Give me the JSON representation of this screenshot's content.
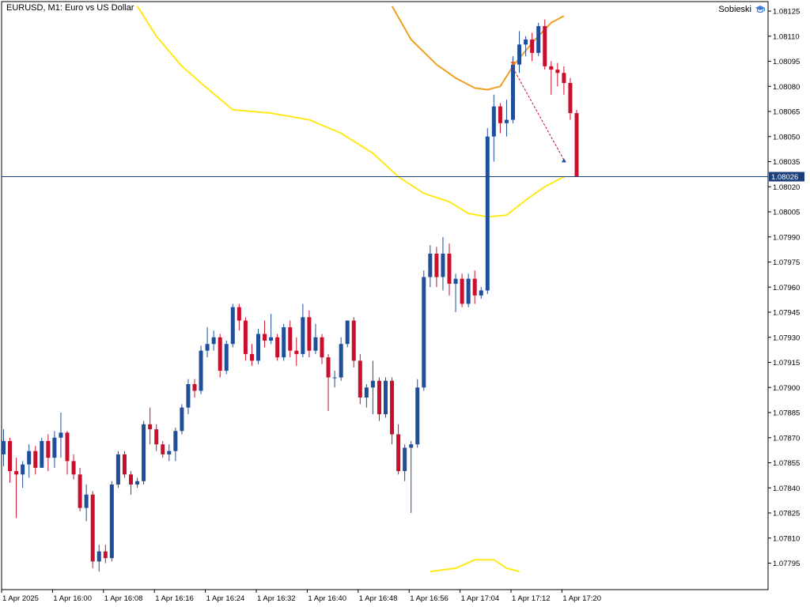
{
  "header": {
    "symbol_label": "EURUSD, M1:  Euro vs US Dollar",
    "account_name": "Sobieski",
    "account_icon": "graduation-cap-icon"
  },
  "colors": {
    "bull": "#1f4e9b",
    "bear": "#c8102e",
    "band_lower": "#ffe81a",
    "band_upper": "#f0a020",
    "price_line": "#1a3f7a",
    "axis": "#000000"
  },
  "chart_data": {
    "type": "candlestick",
    "symbol": "EURUSD",
    "timeframe": "M1",
    "ylim": [
      1.0779,
      1.0813
    ],
    "y_ticks": [
      "1.08125",
      "1.08110",
      "1.08095",
      "1.08080",
      "1.08065",
      "1.08050",
      "1.08035",
      "1.08020",
      "1.08005",
      "1.07990",
      "1.07975",
      "1.07960",
      "1.07945",
      "1.07930",
      "1.07915",
      "1.07900",
      "1.07885",
      "1.07870",
      "1.07855",
      "1.07840",
      "1.07825",
      "1.07810",
      "1.07795"
    ],
    "x_ticks": [
      "1 Apr 2025",
      "1 Apr 16:00",
      "1 Apr 16:08",
      "1 Apr 16:16",
      "1 Apr 16:24",
      "1 Apr 16:32",
      "1 Apr 16:40",
      "1 Apr 16:48",
      "1 Apr 16:56",
      "1 Apr 17:04",
      "1 Apr 17:12",
      "1 Apr 17:20"
    ],
    "current_price": "1.08026",
    "candles": [
      {
        "o": 1.0786,
        "h": 1.07875,
        "l": 1.07853,
        "c": 1.07868
      },
      {
        "o": 1.07868,
        "h": 1.0787,
        "l": 1.07843,
        "c": 1.0785
      },
      {
        "o": 1.0785,
        "h": 1.07858,
        "l": 1.07822,
        "c": 1.07848
      },
      {
        "o": 1.07848,
        "h": 1.07856,
        "l": 1.0784,
        "c": 1.07854
      },
      {
        "o": 1.07854,
        "h": 1.07866,
        "l": 1.07846,
        "c": 1.07862
      },
      {
        "o": 1.07862,
        "h": 1.07865,
        "l": 1.07848,
        "c": 1.07852
      },
      {
        "o": 1.07852,
        "h": 1.0787,
        "l": 1.07852,
        "c": 1.07868
      },
      {
        "o": 1.07868,
        "h": 1.07872,
        "l": 1.0785,
        "c": 1.07858
      },
      {
        "o": 1.07858,
        "h": 1.07874,
        "l": 1.07852,
        "c": 1.0787
      },
      {
        "o": 1.0787,
        "h": 1.07885,
        "l": 1.07858,
        "c": 1.07873
      },
      {
        "o": 1.07873,
        "h": 1.07874,
        "l": 1.07848,
        "c": 1.07856
      },
      {
        "o": 1.07856,
        "h": 1.0786,
        "l": 1.07845,
        "c": 1.07848
      },
      {
        "o": 1.07848,
        "h": 1.07852,
        "l": 1.07826,
        "c": 1.07828
      },
      {
        "o": 1.07828,
        "h": 1.07842,
        "l": 1.0782,
        "c": 1.07836
      },
      {
        "o": 1.07836,
        "h": 1.07838,
        "l": 1.07792,
        "c": 1.07796
      },
      {
        "o": 1.07796,
        "h": 1.07806,
        "l": 1.0779,
        "c": 1.07802
      },
      {
        "o": 1.07802,
        "h": 1.07806,
        "l": 1.07795,
        "c": 1.07798
      },
      {
        "o": 1.07798,
        "h": 1.07844,
        "l": 1.07796,
        "c": 1.07842
      },
      {
        "o": 1.07842,
        "h": 1.07862,
        "l": 1.0784,
        "c": 1.0786
      },
      {
        "o": 1.0786,
        "h": 1.07862,
        "l": 1.07846,
        "c": 1.07848
      },
      {
        "o": 1.07848,
        "h": 1.0785,
        "l": 1.07836,
        "c": 1.07842
      },
      {
        "o": 1.07842,
        "h": 1.07846,
        "l": 1.0784,
        "c": 1.07844
      },
      {
        "o": 1.07844,
        "h": 1.0788,
        "l": 1.07842,
        "c": 1.07878
      },
      {
        "o": 1.07878,
        "h": 1.07888,
        "l": 1.07866,
        "c": 1.07875
      },
      {
        "o": 1.07875,
        "h": 1.07878,
        "l": 1.07862,
        "c": 1.07866
      },
      {
        "o": 1.07866,
        "h": 1.07868,
        "l": 1.07858,
        "c": 1.0786
      },
      {
        "o": 1.0786,
        "h": 1.07866,
        "l": 1.07856,
        "c": 1.07862
      },
      {
        "o": 1.07862,
        "h": 1.07876,
        "l": 1.07856,
        "c": 1.07874
      },
      {
        "o": 1.07874,
        "h": 1.0789,
        "l": 1.07872,
        "c": 1.07888
      },
      {
        "o": 1.07888,
        "h": 1.07905,
        "l": 1.07884,
        "c": 1.07902
      },
      {
        "o": 1.07902,
        "h": 1.07905,
        "l": 1.07894,
        "c": 1.07898
      },
      {
        "o": 1.07898,
        "h": 1.07925,
        "l": 1.07896,
        "c": 1.07922
      },
      {
        "o": 1.07922,
        "h": 1.07936,
        "l": 1.07918,
        "c": 1.07926
      },
      {
        "o": 1.07926,
        "h": 1.07934,
        "l": 1.07922,
        "c": 1.0793
      },
      {
        "o": 1.0793,
        "h": 1.07932,
        "l": 1.07906,
        "c": 1.0791
      },
      {
        "o": 1.0791,
        "h": 1.07928,
        "l": 1.07908,
        "c": 1.07926
      },
      {
        "o": 1.07926,
        "h": 1.0795,
        "l": 1.07924,
        "c": 1.07948
      },
      {
        "o": 1.07948,
        "h": 1.0795,
        "l": 1.07934,
        "c": 1.0794
      },
      {
        "o": 1.0794,
        "h": 1.07942,
        "l": 1.07916,
        "c": 1.0792
      },
      {
        "o": 1.0792,
        "h": 1.07926,
        "l": 1.07913,
        "c": 1.07916
      },
      {
        "o": 1.07916,
        "h": 1.07935,
        "l": 1.07914,
        "c": 1.07932
      },
      {
        "o": 1.07932,
        "h": 1.0794,
        "l": 1.07924,
        "c": 1.07928
      },
      {
        "o": 1.07928,
        "h": 1.07944,
        "l": 1.07926,
        "c": 1.0793
      },
      {
        "o": 1.0793,
        "h": 1.07932,
        "l": 1.07916,
        "c": 1.07918
      },
      {
        "o": 1.07918,
        "h": 1.07938,
        "l": 1.07916,
        "c": 1.07936
      },
      {
        "o": 1.07936,
        "h": 1.0794,
        "l": 1.07918,
        "c": 1.07922
      },
      {
        "o": 1.07922,
        "h": 1.0793,
        "l": 1.07913,
        "c": 1.0792
      },
      {
        "o": 1.0792,
        "h": 1.0795,
        "l": 1.07918,
        "c": 1.07942
      },
      {
        "o": 1.07942,
        "h": 1.07946,
        "l": 1.07918,
        "c": 1.07922
      },
      {
        "o": 1.07922,
        "h": 1.07938,
        "l": 1.0792,
        "c": 1.0793
      },
      {
        "o": 1.0793,
        "h": 1.07932,
        "l": 1.07914,
        "c": 1.07918
      },
      {
        "o": 1.07918,
        "h": 1.0792,
        "l": 1.07886,
        "c": 1.07906
      },
      {
        "o": 1.07906,
        "h": 1.0791,
        "l": 1.079,
        "c": 1.07906
      },
      {
        "o": 1.07906,
        "h": 1.0793,
        "l": 1.07904,
        "c": 1.07926
      },
      {
        "o": 1.07926,
        "h": 1.0794,
        "l": 1.07924,
        "c": 1.0794
      },
      {
        "o": 1.0794,
        "h": 1.07942,
        "l": 1.07912,
        "c": 1.07916
      },
      {
        "o": 1.07916,
        "h": 1.0792,
        "l": 1.0789,
        "c": 1.07894
      },
      {
        "o": 1.07894,
        "h": 1.07902,
        "l": 1.07888,
        "c": 1.079
      },
      {
        "o": 1.079,
        "h": 1.07916,
        "l": 1.07884,
        "c": 1.07904
      },
      {
        "o": 1.07904,
        "h": 1.07906,
        "l": 1.0788,
        "c": 1.07884
      },
      {
        "o": 1.07884,
        "h": 1.07906,
        "l": 1.07882,
        "c": 1.07904
      },
      {
        "o": 1.07904,
        "h": 1.07906,
        "l": 1.07866,
        "c": 1.07872
      },
      {
        "o": 1.07872,
        "h": 1.07878,
        "l": 1.07848,
        "c": 1.0785
      },
      {
        "o": 1.0785,
        "h": 1.07866,
        "l": 1.07844,
        "c": 1.07864
      },
      {
        "o": 1.07864,
        "h": 1.07868,
        "l": 1.07825,
        "c": 1.07866
      },
      {
        "o": 1.07866,
        "h": 1.07905,
        "l": 1.07864,
        "c": 1.079
      },
      {
        "o": 1.079,
        "h": 1.0797,
        "l": 1.07898,
        "c": 1.07966
      },
      {
        "o": 1.07966,
        "h": 1.07985,
        "l": 1.0796,
        "c": 1.0798
      },
      {
        "o": 1.0798,
        "h": 1.07984,
        "l": 1.0796,
        "c": 1.07966
      },
      {
        "o": 1.07966,
        "h": 1.0799,
        "l": 1.07958,
        "c": 1.0798
      },
      {
        "o": 1.0798,
        "h": 1.07986,
        "l": 1.07955,
        "c": 1.07962
      },
      {
        "o": 1.07962,
        "h": 1.07968,
        "l": 1.07945,
        "c": 1.07965
      },
      {
        "o": 1.07965,
        "h": 1.07968,
        "l": 1.07948,
        "c": 1.0795
      },
      {
        "o": 1.0795,
        "h": 1.07968,
        "l": 1.07948,
        "c": 1.07965
      },
      {
        "o": 1.07965,
        "h": 1.0797,
        "l": 1.0795,
        "c": 1.07955
      },
      {
        "o": 1.07955,
        "h": 1.0796,
        "l": 1.07953,
        "c": 1.07958
      },
      {
        "o": 1.07958,
        "h": 1.08055,
        "l": 1.07956,
        "c": 1.0805
      },
      {
        "o": 1.0805,
        "h": 1.08075,
        "l": 1.08035,
        "c": 1.08068
      },
      {
        "o": 1.08068,
        "h": 1.0807,
        "l": 1.08052,
        "c": 1.08058
      },
      {
        "o": 1.08058,
        "h": 1.08072,
        "l": 1.0805,
        "c": 1.0806
      },
      {
        "o": 1.0806,
        "h": 1.08098,
        "l": 1.08058,
        "c": 1.08093
      },
      {
        "o": 1.08093,
        "h": 1.08113,
        "l": 1.08088,
        "c": 1.08105
      },
      {
        "o": 1.08105,
        "h": 1.0811,
        "l": 1.08098,
        "c": 1.08108
      },
      {
        "o": 1.08108,
        "h": 1.08112,
        "l": 1.08095,
        "c": 1.081
      },
      {
        "o": 1.081,
        "h": 1.08118,
        "l": 1.08098,
        "c": 1.08116
      },
      {
        "o": 1.08116,
        "h": 1.0812,
        "l": 1.0809,
        "c": 1.08092
      },
      {
        "o": 1.08092,
        "h": 1.08095,
        "l": 1.08075,
        "c": 1.0809
      },
      {
        "o": 1.0809,
        "h": 1.08094,
        "l": 1.0808,
        "c": 1.08088
      },
      {
        "o": 1.08088,
        "h": 1.08092,
        "l": 1.08075,
        "c": 1.08082
      },
      {
        "o": 1.08082,
        "h": 1.08085,
        "l": 1.0806,
        "c": 1.08064
      },
      {
        "o": 1.08064,
        "h": 1.08066,
        "l": 1.08026,
        "c": 1.08026
      }
    ],
    "band_lower": [
      [
        21,
        1.08128
      ],
      [
        24,
        1.0811
      ],
      [
        28,
        1.08092
      ],
      [
        31,
        1.08082
      ],
      [
        36,
        1.08066
      ],
      [
        42,
        1.08064
      ],
      [
        48,
        1.0806
      ],
      [
        53,
        1.08052
      ],
      [
        58,
        1.0804
      ],
      [
        62,
        1.08026
      ],
      [
        66,
        1.08016
      ],
      [
        70,
        1.08011
      ],
      [
        73,
        1.08004
      ],
      [
        76,
        1.08002
      ],
      [
        79,
        1.08003
      ],
      [
        82,
        1.08012
      ],
      [
        85,
        1.0802
      ],
      [
        88,
        1.08026
      ]
    ],
    "band_upper": [
      [
        61,
        1.08128
      ],
      [
        64,
        1.08108
      ],
      [
        68,
        1.08093
      ],
      [
        71,
        1.08085
      ],
      [
        74,
        1.08079
      ],
      [
        76,
        1.08078
      ],
      [
        78,
        1.0808
      ],
      [
        80,
        1.08092
      ],
      [
        83,
        1.08106
      ],
      [
        86,
        1.08118
      ],
      [
        88,
        1.08122
      ]
    ],
    "band_lower2": [
      [
        67,
        1.0779
      ],
      [
        71,
        1.07792
      ],
      [
        74,
        1.07797
      ],
      [
        77,
        1.07797
      ],
      [
        79,
        1.07792
      ],
      [
        81,
        1.0779
      ]
    ],
    "trade_line": {
      "from": [
        80,
        1.08091
      ],
      "to": [
        88,
        1.08036
      ]
    }
  }
}
